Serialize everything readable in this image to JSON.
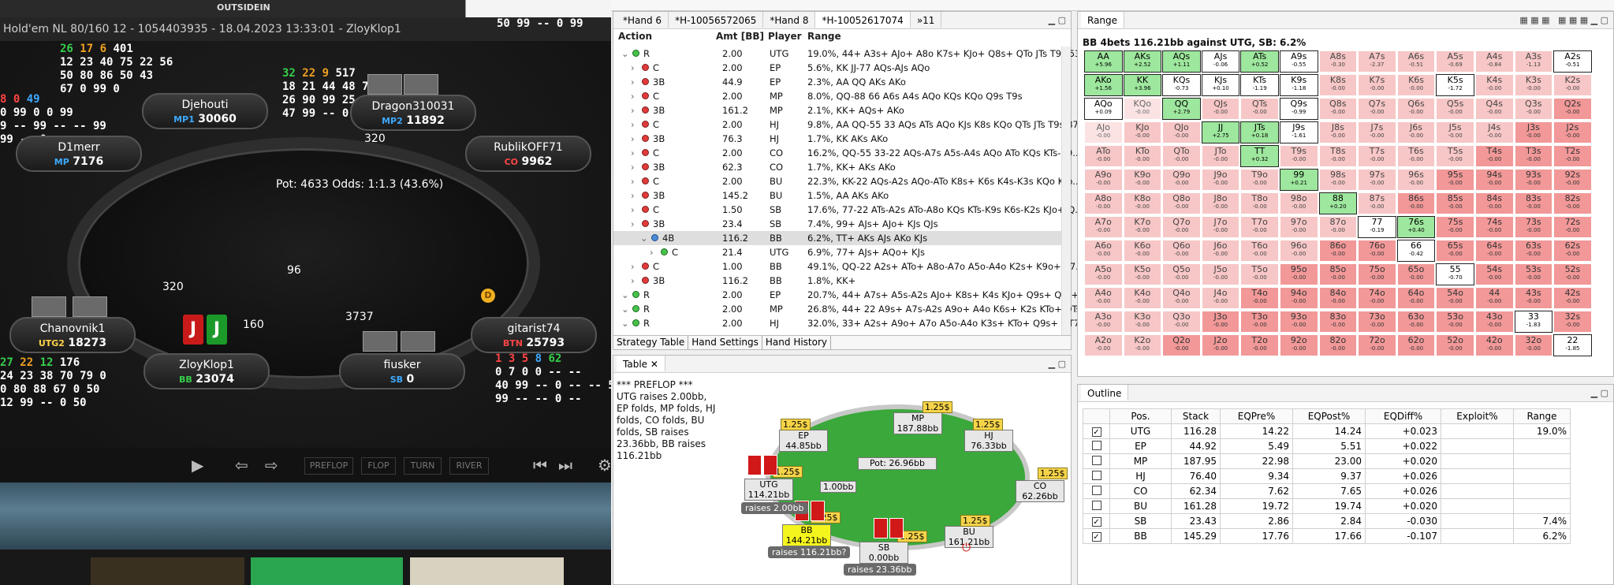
{
  "poker": {
    "title": "Hold'em NL 80/160 12 - 1054403935 - 18.04.2023 13:33:01 - ZloyKlop1",
    "top_banner": "OUTSIDEIN",
    "hud_top_right": "50 99 -- 0 99",
    "pot_line": "Pot:  4633    Odds:  1:1.3 (43.6%)",
    "seats": [
      {
        "name": "Djehouti",
        "pos": "MP1",
        "stack": "30060"
      },
      {
        "name": "Dragon310031",
        "pos": "MP2",
        "stack": "11892"
      },
      {
        "name": "D1merr",
        "pos": "MP",
        "stack": "7176"
      },
      {
        "name": "RublikOFF71",
        "pos": "CO",
        "stack": "9962"
      },
      {
        "name": "Chanovnik1",
        "pos": "UTG2",
        "stack": "18273"
      },
      {
        "name": "gitarist74",
        "pos": "BTN",
        "stack": "25793"
      },
      {
        "name": "ZloyKlop1",
        "pos": "BB",
        "stack": "23074"
      },
      {
        "name": "fiusker",
        "pos": "SB",
        "stack": "0"
      }
    ],
    "bets": {
      "dragon": "320",
      "chanovnik": "320",
      "center": "96",
      "hero": "160",
      "fiusker": "3737"
    },
    "hero_cards": [
      "J",
      "J"
    ],
    "controls": [
      "PREFLOP",
      "FLOP",
      "TURN",
      "RIVER"
    ]
  },
  "strategy": {
    "tabs": [
      "*Hand 6",
      "*H-10056572065",
      "*Hand 8",
      "*H-10052617074",
      "»11"
    ],
    "columns": [
      "Action",
      "Amt [BB]",
      "Player",
      "Range"
    ],
    "rows": [
      {
        "a": "R",
        "amt": "2.00",
        "p": "UTG",
        "r": "19.0%, 44+ A3s+ AJo+ A8o K7s+ KJo+ Q8s+ QTo JTs T9s 53s",
        "lvl": 0,
        "dot": "green"
      },
      {
        "a": "C",
        "amt": "2.00",
        "p": "EP",
        "r": "5.6%, KK JJ-77 AQs-AJs AQo",
        "lvl": 1,
        "dot": "red"
      },
      {
        "a": "3B",
        "amt": "44.9",
        "p": "EP",
        "r": "2.3%, AA QQ AKs AKo",
        "lvl": 1,
        "dot": "red"
      },
      {
        "a": "C",
        "amt": "2.00",
        "p": "MP",
        "r": "8.0%, QQ-88 66 A6s A4s AQo KQs KQo Q9s T9s",
        "lvl": 1,
        "dot": "red"
      },
      {
        "a": "3B",
        "amt": "161.2",
        "p": "MP",
        "r": "2.1%, KK+ AQs+ AKo",
        "lvl": 1,
        "dot": "red"
      },
      {
        "a": "C",
        "amt": "2.00",
        "p": "HJ",
        "r": "9.8%, AA QQ-55 33 AQs ATs AQo KJs K8s KQo QTs JTs T9s 87s",
        "lvl": 1,
        "dot": "red"
      },
      {
        "a": "3B",
        "amt": "76.3",
        "p": "HJ",
        "r": "1.7%, KK AKs AKo",
        "lvl": 1,
        "dot": "red"
      },
      {
        "a": "C",
        "amt": "2.00",
        "p": "CO",
        "r": "16.2%, QQ-55 33-22 AQs-A7s A5s-A4s AQo ATo KQs KTs-K9...",
        "lvl": 1,
        "dot": "red"
      },
      {
        "a": "3B",
        "amt": "62.3",
        "p": "CO",
        "r": "1.7%, KK+ AKs AKo",
        "lvl": 1,
        "dot": "red"
      },
      {
        "a": "C",
        "amt": "2.00",
        "p": "BU",
        "r": "22.3%, KK-22 AQs-A2s AQo-ATo K8s+ K6s K4s-K3s KQo KTo...",
        "lvl": 1,
        "dot": "red"
      },
      {
        "a": "3B",
        "amt": "145.2",
        "p": "BU",
        "r": "1.5%, AA AKs AKo",
        "lvl": 1,
        "dot": "red"
      },
      {
        "a": "C",
        "amt": "1.50",
        "p": "SB",
        "r": "17.6%, 77-22 ATs-A2s ATo-A8o KQs KTs-K9s K6s-K2s KJo+ Q...",
        "lvl": 1,
        "dot": "red"
      },
      {
        "a": "3B",
        "amt": "23.4",
        "p": "SB",
        "r": "7.4%, 99+ AJs+ AJo+ KJs QJs",
        "lvl": 1,
        "dot": "red"
      },
      {
        "a": "4B",
        "amt": "116.2",
        "p": "BB",
        "r": "6.2%, TT+ AKs AJs AKo KJs",
        "lvl": 2,
        "dot": "blue",
        "sel": true
      },
      {
        "a": "C",
        "amt": "21.4",
        "p": "UTG",
        "r": "6.9%, 77+ AJs+ AQo+ KJs",
        "lvl": 3,
        "dot": "green"
      },
      {
        "a": "C",
        "amt": "1.00",
        "p": "BB",
        "r": "49.1%, QQ-22 A2s+ ATo+ A8o-A7o A5o-A4o K2s+ K9o+ K7...",
        "lvl": 1,
        "dot": "red"
      },
      {
        "a": "3B",
        "amt": "116.2",
        "p": "BB",
        "r": "1.8%, KK+",
        "lvl": 1,
        "dot": "red"
      },
      {
        "a": "R",
        "amt": "2.00",
        "p": "EP",
        "r": "20.7%, 44+ A7s+ A5s-A2s AJo+ K8s+ K4s KJo+ Q9s+ QTo+ ...",
        "lvl": 0,
        "dot": "green"
      },
      {
        "a": "R",
        "amt": "2.00",
        "p": "MP",
        "r": "26.8%, 44+ 22 A9s+ A7s-A2s A9o+ A4o K6s+ K2s KTo+ QTs...",
        "lvl": 0,
        "dot": "green"
      },
      {
        "a": "R",
        "amt": "2.00",
        "p": "HJ",
        "r": "32.0%, 33+ A2s+ A9o+ A7o A5o-A4o K3s+ KTo+ Q9s+ QT7s-...",
        "lvl": 0,
        "dot": "green"
      }
    ],
    "bottom_tabs": [
      "Strategy Table",
      "Hand Settings",
      "Hand History"
    ]
  },
  "table_viz": {
    "title": "Table",
    "text": "*** PREFLOP ***\nUTG raises 2.00bb, EP folds, MP folds, HJ folds, CO folds, BU folds, SB raises 23.36bb, BB raises 116.21bb",
    "pot": "Pot:   26.96bb",
    "center_bet": "1.00bb",
    "players": [
      {
        "pos": "MP",
        "stack": "187.88bb",
        "ante": "1.25$"
      },
      {
        "pos": "EP",
        "stack": "44.85bb",
        "ante": "1.25$"
      },
      {
        "pos": "HJ",
        "stack": "76.33bb",
        "ante": "1.25$"
      },
      {
        "pos": "CO",
        "stack": "62.26bb",
        "ante": "1.25$"
      },
      {
        "pos": "UTG",
        "stack": "114.21bb",
        "ante": "1.25$"
      },
      {
        "pos": "BB",
        "stack": "144.21bb",
        "ante": "1.25$"
      },
      {
        "pos": "SB",
        "stack": "0.00bb",
        "ante": "1.25$"
      },
      {
        "pos": "BU",
        "stack": "161.21bb",
        "ante": "1.25$"
      }
    ],
    "labels": {
      "utg": "raises 2.00bb",
      "bb": "raises 116.21bb?",
      "sb": "raises 23.36bb"
    }
  },
  "range": {
    "title": "Range",
    "subtitle": "BB 4bets 116.21bb against UTG, SB: 6.2%",
    "ranks": [
      "A",
      "K",
      "Q",
      "J",
      "T",
      "9",
      "8",
      "7",
      "6",
      "5",
      "4",
      "3",
      "2"
    ],
    "green": [
      "AA",
      "AKs",
      "AQs",
      "ATs",
      "AKo",
      "KK",
      "QQ",
      "JJ",
      "JTs",
      "TT",
      "99",
      "88",
      "76s"
    ],
    "white": [
      "AJs",
      "A9s",
      "A2s",
      "KQs",
      "KJs",
      "KTs",
      "K9s",
      "K5s",
      "AQo",
      "Q9s",
      "J9s",
      "77",
      "66",
      "55",
      "33",
      "22"
    ],
    "ev": {
      "AA": "+5.96",
      "AKs": "+2.52",
      "AQs": "+1.11",
      "AJs": "-0.06",
      "ATs": "+0.52",
      "A9s": "-0.55",
      "A8s": "-0.30",
      "A7s": "-2.37",
      "A6s": "-0.51",
      "A5s": "-0.69",
      "A4s": "-0.84",
      "A3s": "-1.13",
      "A2s": "-0.51",
      "AKo": "+1.56",
      "KK": "+3.96",
      "KQs": "-0.73",
      "KJs": "+0.10",
      "KTs": "-1.19",
      "K9s": "-1.18",
      "K5s": "-1.72",
      "AQo": "+0.09",
      "QQ": "+2.79",
      "Q9s": "-0.99",
      "JJ": "+2.75",
      "JTs": "+0.18",
      "J9s": "-1.61",
      "TT": "+0.32",
      "99": "+0.21",
      "88": "+0.20",
      "77": "-0.19",
      "76s": "+0.40",
      "66": "-0.42",
      "55": "-0.70",
      "33": "-1.83",
      "22": "-1.85"
    }
  },
  "outline": {
    "title": "Outline",
    "columns": [
      "",
      "Pos.",
      "Stack",
      "EQPre%",
      "EQPost%",
      "EQDiff%",
      "Exploit%",
      "Range"
    ],
    "rows": [
      {
        "chk": true,
        "pos": "UTG",
        "stack": "116.28",
        "pre": "14.22",
        "post": "14.24",
        "diff": "+0.023",
        "exp": "",
        "range": "19.0%"
      },
      {
        "chk": false,
        "pos": "EP",
        "stack": "44.92",
        "pre": "5.49",
        "post": "5.51",
        "diff": "+0.022",
        "exp": "",
        "range": ""
      },
      {
        "chk": false,
        "pos": "MP",
        "stack": "187.95",
        "pre": "22.98",
        "post": "23.00",
        "diff": "+0.020",
        "exp": "",
        "range": ""
      },
      {
        "chk": false,
        "pos": "HJ",
        "stack": "76.40",
        "pre": "9.34",
        "post": "9.37",
        "diff": "+0.026",
        "exp": "",
        "range": ""
      },
      {
        "chk": false,
        "pos": "CO",
        "stack": "62.34",
        "pre": "7.62",
        "post": "7.65",
        "diff": "+0.026",
        "exp": "",
        "range": ""
      },
      {
        "chk": false,
        "pos": "BU",
        "stack": "161.28",
        "pre": "19.72",
        "post": "19.74",
        "diff": "+0.020",
        "exp": "",
        "range": ""
      },
      {
        "chk": true,
        "pos": "SB",
        "stack": "23.43",
        "pre": "2.86",
        "post": "2.84",
        "diff": "-0.030",
        "exp": "",
        "range": "7.4%"
      },
      {
        "chk": true,
        "pos": "BB",
        "stack": "145.29",
        "pre": "17.76",
        "post": "17.66",
        "diff": "-0.107",
        "exp": "",
        "range": "6.2%"
      }
    ]
  }
}
